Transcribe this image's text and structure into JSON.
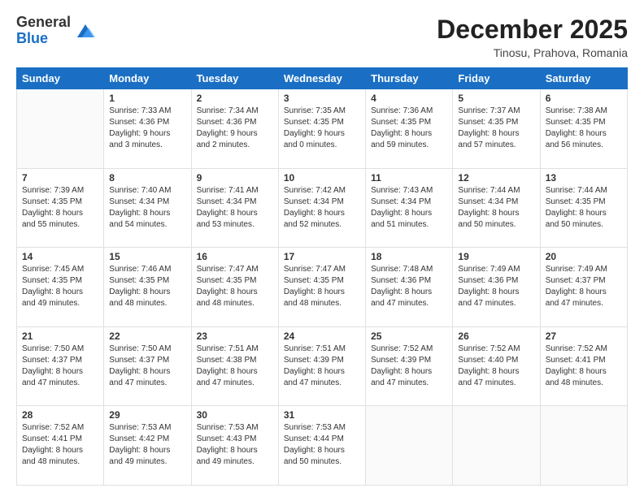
{
  "logo": {
    "general": "General",
    "blue": "Blue"
  },
  "title": "December 2025",
  "subtitle": "Tinosu, Prahova, Romania",
  "weekdays": [
    "Sunday",
    "Monday",
    "Tuesday",
    "Wednesday",
    "Thursday",
    "Friday",
    "Saturday"
  ],
  "weeks": [
    [
      {
        "day": "",
        "sunrise": "",
        "sunset": "",
        "daylight": ""
      },
      {
        "day": "1",
        "sunrise": "Sunrise: 7:33 AM",
        "sunset": "Sunset: 4:36 PM",
        "daylight": "Daylight: 9 hours and 3 minutes."
      },
      {
        "day": "2",
        "sunrise": "Sunrise: 7:34 AM",
        "sunset": "Sunset: 4:36 PM",
        "daylight": "Daylight: 9 hours and 2 minutes."
      },
      {
        "day": "3",
        "sunrise": "Sunrise: 7:35 AM",
        "sunset": "Sunset: 4:35 PM",
        "daylight": "Daylight: 9 hours and 0 minutes."
      },
      {
        "day": "4",
        "sunrise": "Sunrise: 7:36 AM",
        "sunset": "Sunset: 4:35 PM",
        "daylight": "Daylight: 8 hours and 59 minutes."
      },
      {
        "day": "5",
        "sunrise": "Sunrise: 7:37 AM",
        "sunset": "Sunset: 4:35 PM",
        "daylight": "Daylight: 8 hours and 57 minutes."
      },
      {
        "day": "6",
        "sunrise": "Sunrise: 7:38 AM",
        "sunset": "Sunset: 4:35 PM",
        "daylight": "Daylight: 8 hours and 56 minutes."
      }
    ],
    [
      {
        "day": "7",
        "sunrise": "Sunrise: 7:39 AM",
        "sunset": "Sunset: 4:35 PM",
        "daylight": "Daylight: 8 hours and 55 minutes."
      },
      {
        "day": "8",
        "sunrise": "Sunrise: 7:40 AM",
        "sunset": "Sunset: 4:34 PM",
        "daylight": "Daylight: 8 hours and 54 minutes."
      },
      {
        "day": "9",
        "sunrise": "Sunrise: 7:41 AM",
        "sunset": "Sunset: 4:34 PM",
        "daylight": "Daylight: 8 hours and 53 minutes."
      },
      {
        "day": "10",
        "sunrise": "Sunrise: 7:42 AM",
        "sunset": "Sunset: 4:34 PM",
        "daylight": "Daylight: 8 hours and 52 minutes."
      },
      {
        "day": "11",
        "sunrise": "Sunrise: 7:43 AM",
        "sunset": "Sunset: 4:34 PM",
        "daylight": "Daylight: 8 hours and 51 minutes."
      },
      {
        "day": "12",
        "sunrise": "Sunrise: 7:44 AM",
        "sunset": "Sunset: 4:34 PM",
        "daylight": "Daylight: 8 hours and 50 minutes."
      },
      {
        "day": "13",
        "sunrise": "Sunrise: 7:44 AM",
        "sunset": "Sunset: 4:35 PM",
        "daylight": "Daylight: 8 hours and 50 minutes."
      }
    ],
    [
      {
        "day": "14",
        "sunrise": "Sunrise: 7:45 AM",
        "sunset": "Sunset: 4:35 PM",
        "daylight": "Daylight: 8 hours and 49 minutes."
      },
      {
        "day": "15",
        "sunrise": "Sunrise: 7:46 AM",
        "sunset": "Sunset: 4:35 PM",
        "daylight": "Daylight: 8 hours and 48 minutes."
      },
      {
        "day": "16",
        "sunrise": "Sunrise: 7:47 AM",
        "sunset": "Sunset: 4:35 PM",
        "daylight": "Daylight: 8 hours and 48 minutes."
      },
      {
        "day": "17",
        "sunrise": "Sunrise: 7:47 AM",
        "sunset": "Sunset: 4:35 PM",
        "daylight": "Daylight: 8 hours and 48 minutes."
      },
      {
        "day": "18",
        "sunrise": "Sunrise: 7:48 AM",
        "sunset": "Sunset: 4:36 PM",
        "daylight": "Daylight: 8 hours and 47 minutes."
      },
      {
        "day": "19",
        "sunrise": "Sunrise: 7:49 AM",
        "sunset": "Sunset: 4:36 PM",
        "daylight": "Daylight: 8 hours and 47 minutes."
      },
      {
        "day": "20",
        "sunrise": "Sunrise: 7:49 AM",
        "sunset": "Sunset: 4:37 PM",
        "daylight": "Daylight: 8 hours and 47 minutes."
      }
    ],
    [
      {
        "day": "21",
        "sunrise": "Sunrise: 7:50 AM",
        "sunset": "Sunset: 4:37 PM",
        "daylight": "Daylight: 8 hours and 47 minutes."
      },
      {
        "day": "22",
        "sunrise": "Sunrise: 7:50 AM",
        "sunset": "Sunset: 4:37 PM",
        "daylight": "Daylight: 8 hours and 47 minutes."
      },
      {
        "day": "23",
        "sunrise": "Sunrise: 7:51 AM",
        "sunset": "Sunset: 4:38 PM",
        "daylight": "Daylight: 8 hours and 47 minutes."
      },
      {
        "day": "24",
        "sunrise": "Sunrise: 7:51 AM",
        "sunset": "Sunset: 4:39 PM",
        "daylight": "Daylight: 8 hours and 47 minutes."
      },
      {
        "day": "25",
        "sunrise": "Sunrise: 7:52 AM",
        "sunset": "Sunset: 4:39 PM",
        "daylight": "Daylight: 8 hours and 47 minutes."
      },
      {
        "day": "26",
        "sunrise": "Sunrise: 7:52 AM",
        "sunset": "Sunset: 4:40 PM",
        "daylight": "Daylight: 8 hours and 47 minutes."
      },
      {
        "day": "27",
        "sunrise": "Sunrise: 7:52 AM",
        "sunset": "Sunset: 4:41 PM",
        "daylight": "Daylight: 8 hours and 48 minutes."
      }
    ],
    [
      {
        "day": "28",
        "sunrise": "Sunrise: 7:52 AM",
        "sunset": "Sunset: 4:41 PM",
        "daylight": "Daylight: 8 hours and 48 minutes."
      },
      {
        "day": "29",
        "sunrise": "Sunrise: 7:53 AM",
        "sunset": "Sunset: 4:42 PM",
        "daylight": "Daylight: 8 hours and 49 minutes."
      },
      {
        "day": "30",
        "sunrise": "Sunrise: 7:53 AM",
        "sunset": "Sunset: 4:43 PM",
        "daylight": "Daylight: 8 hours and 49 minutes."
      },
      {
        "day": "31",
        "sunrise": "Sunrise: 7:53 AM",
        "sunset": "Sunset: 4:44 PM",
        "daylight": "Daylight: 8 hours and 50 minutes."
      },
      {
        "day": "",
        "sunrise": "",
        "sunset": "",
        "daylight": ""
      },
      {
        "day": "",
        "sunrise": "",
        "sunset": "",
        "daylight": ""
      },
      {
        "day": "",
        "sunrise": "",
        "sunset": "",
        "daylight": ""
      }
    ]
  ]
}
